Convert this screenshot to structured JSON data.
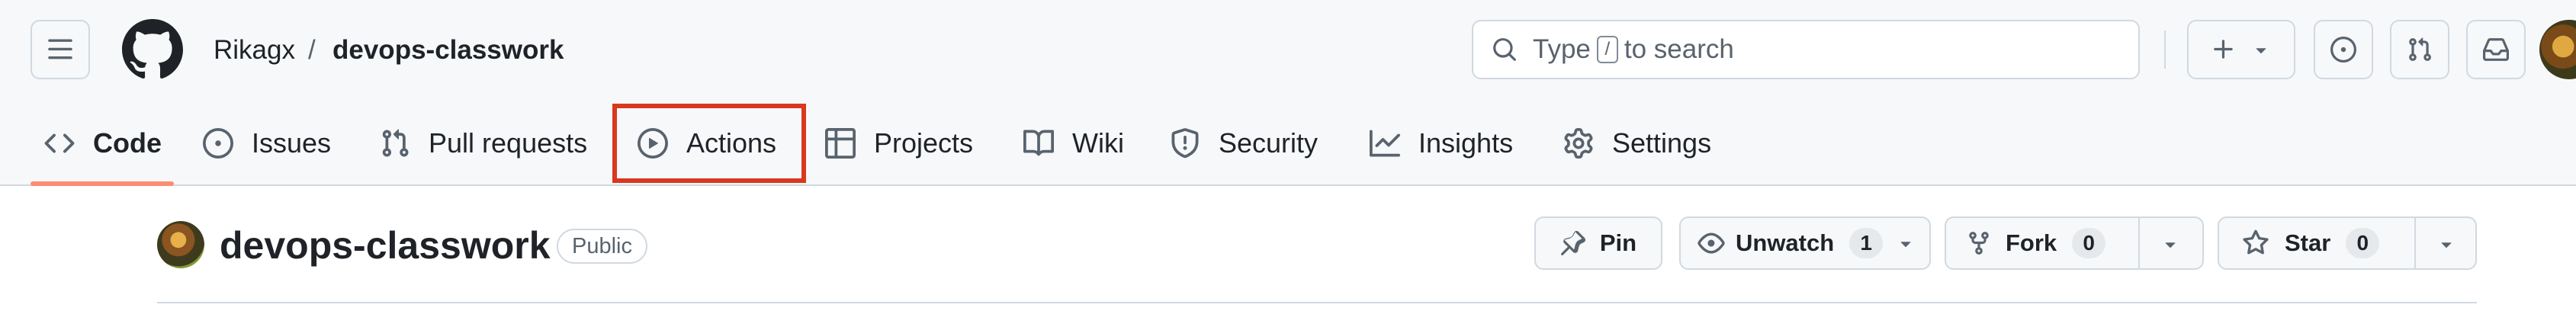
{
  "header": {
    "owner": "Rikagx",
    "separator": "/",
    "repo": "devops-classwork",
    "search": {
      "prefix": "Type",
      "key": "/",
      "suffix": "to search"
    },
    "icons": [
      "hamburger-icon",
      "github-logo-icon",
      "plus-icon",
      "triangle-down-icon",
      "issue-opened-icon",
      "git-pull-request-icon",
      "inbox-icon",
      "avatar"
    ]
  },
  "nav": {
    "tabs": [
      {
        "label": "Code",
        "icon": "code-icon",
        "selected": true
      },
      {
        "label": "Issues",
        "icon": "issue-opened-icon"
      },
      {
        "label": "Pull requests",
        "icon": "git-pull-request-icon"
      },
      {
        "label": "Actions",
        "icon": "play-icon",
        "highlighted": true
      },
      {
        "label": "Projects",
        "icon": "table-icon"
      },
      {
        "label": "Wiki",
        "icon": "book-icon"
      },
      {
        "label": "Security",
        "icon": "shield-icon"
      },
      {
        "label": "Insights",
        "icon": "graph-icon"
      },
      {
        "label": "Settings",
        "icon": "gear-icon"
      }
    ]
  },
  "repo_header": {
    "name": "devops-classwork",
    "visibility": "Public",
    "pin_label": "Pin",
    "watch_label": "Unwatch",
    "watch_count": "1",
    "fork_label": "Fork",
    "fork_count": "0",
    "star_label": "Star",
    "star_count": "0"
  },
  "colors": {
    "selected_tab_underline": "#fd8c73",
    "annotation_box": "#d9381e",
    "header_background": "#f6f8fa",
    "border": "#d1d9e0"
  }
}
